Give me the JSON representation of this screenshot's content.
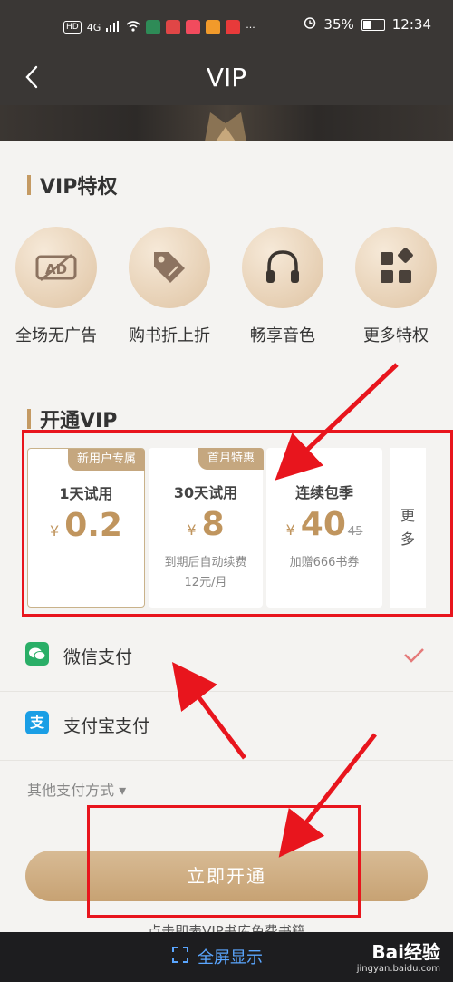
{
  "status_bar": {
    "hd": "HD",
    "signal": "4G",
    "battery": "35%",
    "time": "12:34",
    "more": "···"
  },
  "nav": {
    "title": "VIP"
  },
  "privileges": {
    "title": "VIP特权",
    "items": [
      {
        "label": "全场无广告",
        "icon": "ad-block-icon"
      },
      {
        "label": "购书折上折",
        "icon": "price-tag-icon"
      },
      {
        "label": "畅享音色",
        "icon": "headphones-icon"
      },
      {
        "label": "更多特权",
        "icon": "grid-more-icon"
      }
    ]
  },
  "plans": {
    "title": "开通VIP",
    "items": [
      {
        "tag": "新用户专属",
        "name": "1天试用",
        "currency": "¥",
        "price": "0.2",
        "note_line1": "",
        "note_line2": "",
        "selected": true
      },
      {
        "tag": "首月特惠",
        "name": "30天试用",
        "currency": "¥",
        "price": "8",
        "note_line1": "到期后自动续费",
        "note_line2": "12元/月",
        "selected": false
      },
      {
        "tag": "",
        "name": "连续包季",
        "currency": "¥",
        "price": "40",
        "original_price": "45",
        "note_line1": "加赠666书券",
        "note_line2": "",
        "selected": false
      }
    ],
    "more_label_1": "更",
    "more_label_2": "多"
  },
  "payment": {
    "methods": [
      {
        "label": "微信支付",
        "icon": "wechat-pay-icon",
        "selected": true
      },
      {
        "label": "支付宝支付",
        "icon": "alipay-icon",
        "selected": false
      }
    ],
    "other_label": "其他支付方式 ▾"
  },
  "cta": {
    "label": "立即开通"
  },
  "agreement": {
    "text": "点击即表VIP书库免费书籍"
  },
  "bottom_bar": {
    "fullscreen_label": "全屏显示",
    "watermark": "Bai经验",
    "watermark_sub": "jingyan.baidu.com"
  },
  "colors": {
    "accent": "#c49a63",
    "annotation": "#e8151d",
    "wechat": "#2aae67",
    "alipay": "#1a9ee5"
  }
}
